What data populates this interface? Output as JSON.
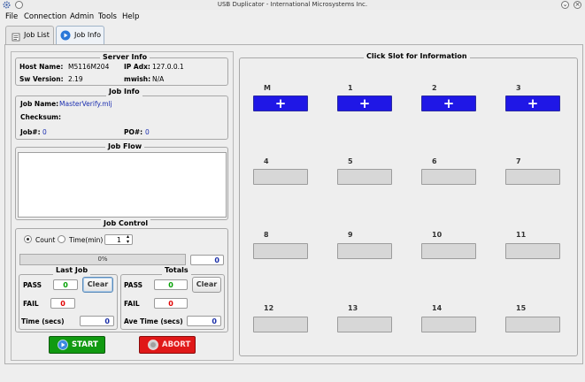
{
  "window": {
    "title": "USB Duplicator - International Microsystems Inc."
  },
  "menu": [
    "File",
    "Connection",
    "Admin",
    "Tools",
    "Help"
  ],
  "tabs": [
    {
      "label": "Job List",
      "active": false
    },
    {
      "label": "Job Info",
      "active": true
    }
  ],
  "server_info": {
    "title": "Server Info",
    "host_name_label": "Host Name:",
    "host_name": "M5116M204",
    "ip_label": "IP Adx:",
    "ip": "127.0.0.1",
    "sw_label": "Sw Version:",
    "sw": "2.19",
    "mwish_label": "mwish:",
    "mwish": "N/A"
  },
  "job_info": {
    "title": "Job Info",
    "job_name_label": "Job Name:",
    "job_name": "MasterVerify.mlj",
    "checksum_label": "Checksum:",
    "job_num_label": "Job#:",
    "job_num": "0",
    "po_label": "PO#:",
    "po": "0"
  },
  "job_flow": {
    "title": "Job Flow"
  },
  "job_control": {
    "title": "Job Control",
    "count_label": "Count",
    "time_label": "Time(min)",
    "spin_value": "1",
    "progress": "0%",
    "progress_fraction": 0,
    "count_value": "0"
  },
  "last_job": {
    "title": "Last Job",
    "pass_label": "PASS",
    "pass": "0",
    "fail_label": "FAIL",
    "fail": "0",
    "time_label": "Time (secs)",
    "time": "0",
    "clear": "Clear"
  },
  "totals": {
    "title": "Totals",
    "pass_label": "PASS",
    "pass": "0",
    "fail_label": "FAIL",
    "fail": "0",
    "time_label": "Ave Time (secs)",
    "time": "0",
    "clear": "Clear"
  },
  "actions": {
    "start": "START",
    "abort": "ABORT"
  },
  "slots_panel": {
    "title": "Click Slot for Information",
    "slots": [
      {
        "label": "M",
        "active": true,
        "symbol": "+"
      },
      {
        "label": "1",
        "active": true,
        "symbol": "+"
      },
      {
        "label": "2",
        "active": true,
        "symbol": "+"
      },
      {
        "label": "3",
        "active": true,
        "symbol": "+"
      },
      {
        "label": "4",
        "active": false,
        "symbol": ""
      },
      {
        "label": "5",
        "active": false,
        "symbol": ""
      },
      {
        "label": "6",
        "active": false,
        "symbol": ""
      },
      {
        "label": "7",
        "active": false,
        "symbol": ""
      },
      {
        "label": "8",
        "active": false,
        "symbol": ""
      },
      {
        "label": "9",
        "active": false,
        "symbol": ""
      },
      {
        "label": "10",
        "active": false,
        "symbol": ""
      },
      {
        "label": "11",
        "active": false,
        "symbol": ""
      },
      {
        "label": "12",
        "active": false,
        "symbol": ""
      },
      {
        "label": "13",
        "active": false,
        "symbol": ""
      },
      {
        "label": "14",
        "active": false,
        "symbol": ""
      },
      {
        "label": "15",
        "active": false,
        "symbol": ""
      }
    ]
  },
  "colors": {
    "slot_active": "#1f17e6",
    "start": "#109410",
    "abort": "#e01818",
    "pass": "#00a000",
    "fail": "#e00000"
  }
}
